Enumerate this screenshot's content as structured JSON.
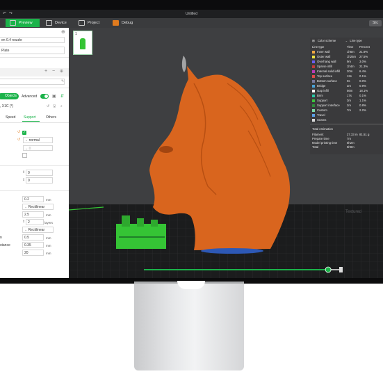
{
  "window": {
    "title": "Untitled"
  },
  "tabs": [
    {
      "label": "Preview",
      "active": true
    },
    {
      "label": "Device"
    },
    {
      "label": "Project"
    },
    {
      "label": "Debug"
    }
  ],
  "slice_button": "Slic",
  "left_panel": {
    "printer_preset": "en 0.4 nozzle",
    "plate": "Plate",
    "mode": {
      "objects_label": "Objects",
      "advanced_label": "Advanced"
    },
    "filament_code": ", X1C (*)",
    "tabs": [
      "Speed",
      "Support",
      "Others"
    ],
    "active_tab": "Support",
    "support_type": "normal",
    "support_value": "0",
    "threshold_values": [
      "0",
      "0"
    ],
    "fields": [
      {
        "value": "0.2",
        "unit": "mm"
      },
      {
        "value": "Rectilinear"
      },
      {
        "value": "2.5",
        "unit": "mm"
      },
      {
        "value": "2",
        "unit": "layers"
      },
      {
        "value": "Rectilinear"
      },
      {
        "value": "0.5",
        "unit": "mm"
      },
      {
        "value": "0.35",
        "unit": "mm"
      },
      {
        "value": "20",
        "unit": "mm"
      }
    ],
    "row_labels": [
      "n",
      "stance"
    ]
  },
  "legend": {
    "header": {
      "scheme": "Color scheme",
      "type": "Line type"
    },
    "columns": [
      "Line type",
      "Time",
      "Percent"
    ],
    "rows": [
      {
        "name": "Inner wall",
        "time": "1h6m",
        "percent": "21.9%",
        "color": "#f0a742"
      },
      {
        "name": "Outer wall",
        "time": "1h25m",
        "percent": "27.5%",
        "color": "#f0e442"
      },
      {
        "name": "Overhang wall",
        "time": "9m",
        "percent": "3.0%",
        "color": "#6b5cf2"
      },
      {
        "name": "Sparse infill",
        "time": "1h4m",
        "percent": "21.3%",
        "color": "#c23b3b"
      },
      {
        "name": "Internal solid infill",
        "time": "20m",
        "percent": "6.4%",
        "color": "#b93ab9"
      },
      {
        "name": "Top surface",
        "time": "13s",
        "percent": "0.1%",
        "color": "#e04a4a"
      },
      {
        "name": "Bottom surface",
        "time": "0s",
        "percent": "0.0%",
        "color": "#7a7a9e"
      },
      {
        "name": "Bridge",
        "time": "2m",
        "percent": "0.9%",
        "color": "#4aa3d8"
      },
      {
        "name": "Gap infill",
        "time": "56m",
        "percent": "18.1%",
        "color": "#ffffff"
      },
      {
        "name": "Brim",
        "time": "17s",
        "percent": "0.1%",
        "color": "#2ac9a6"
      },
      {
        "name": "Support",
        "time": "3m",
        "percent": "1.1%",
        "color": "#3ec43e"
      },
      {
        "name": "Support interface",
        "time": "2m",
        "percent": "0.8%",
        "color": "#2e8c3c"
      },
      {
        "name": "Custom",
        "time": "7m",
        "percent": "2.2%",
        "color": "#7ed9a8"
      },
      {
        "name": "Travel",
        "time": "",
        "percent": "",
        "color": "#5aa0e6"
      },
      {
        "name": "Seams",
        "time": "",
        "percent": "",
        "color": "#d9d9d9"
      }
    ],
    "total_estimation": "Total estimation",
    "filament_label": "Filament",
    "filament_len": "27.33 m",
    "filament_weight": "81.51 g",
    "prepare_label": "Prepare time",
    "prepare_value": "7m",
    "model_label": "Model printing time",
    "model_value": "5h2m",
    "total_label": "Total",
    "total_value": "5h9m"
  },
  "plate_thumbnail": {
    "index": "1"
  },
  "layer_slider": {
    "value": 0.93
  },
  "colors": {
    "accent": "#1bb34a",
    "model": "#d9651e",
    "support": "#35c435"
  }
}
